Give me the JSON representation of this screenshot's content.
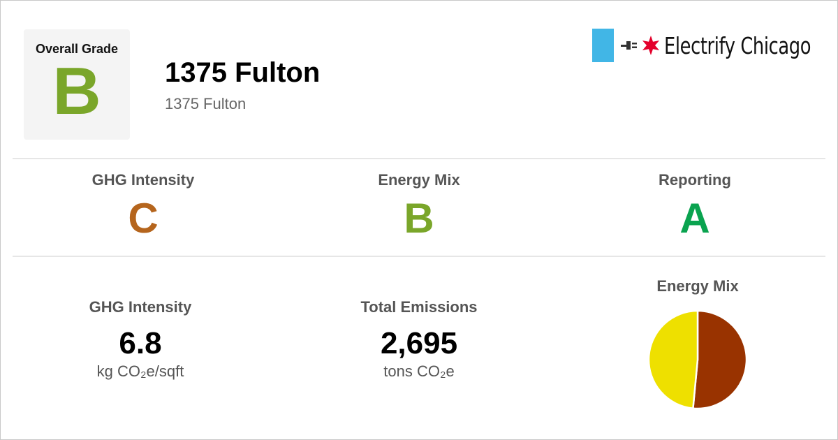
{
  "header": {
    "overall_grade_label": "Overall Grade",
    "overall_grade": "B",
    "building_name": "1375 Fulton",
    "building_address": "1375 Fulton",
    "logo_text": "Electrify Chicago"
  },
  "grades": [
    {
      "label": "GHG Intensity",
      "grade": "C",
      "color": "#b5651d"
    },
    {
      "label": "Energy Mix",
      "grade": "B",
      "color": "#7aa62a"
    },
    {
      "label": "Reporting",
      "grade": "A",
      "color": "#0aa34f"
    }
  ],
  "stats": {
    "ghg_intensity": {
      "label": "GHG Intensity",
      "value": "6.8",
      "unit": "kg CO₂e/sqft"
    },
    "total_emissions": {
      "label": "Total Emissions",
      "value": "2,695",
      "unit": "tons CO₂e"
    },
    "energy_mix_title": "Energy Mix"
  },
  "chart_data": {
    "type": "pie",
    "title": "Energy Mix",
    "slices": [
      {
        "value": 51.5,
        "color": "#993300"
      },
      {
        "value": 48.5,
        "color": "#eee000"
      }
    ]
  }
}
